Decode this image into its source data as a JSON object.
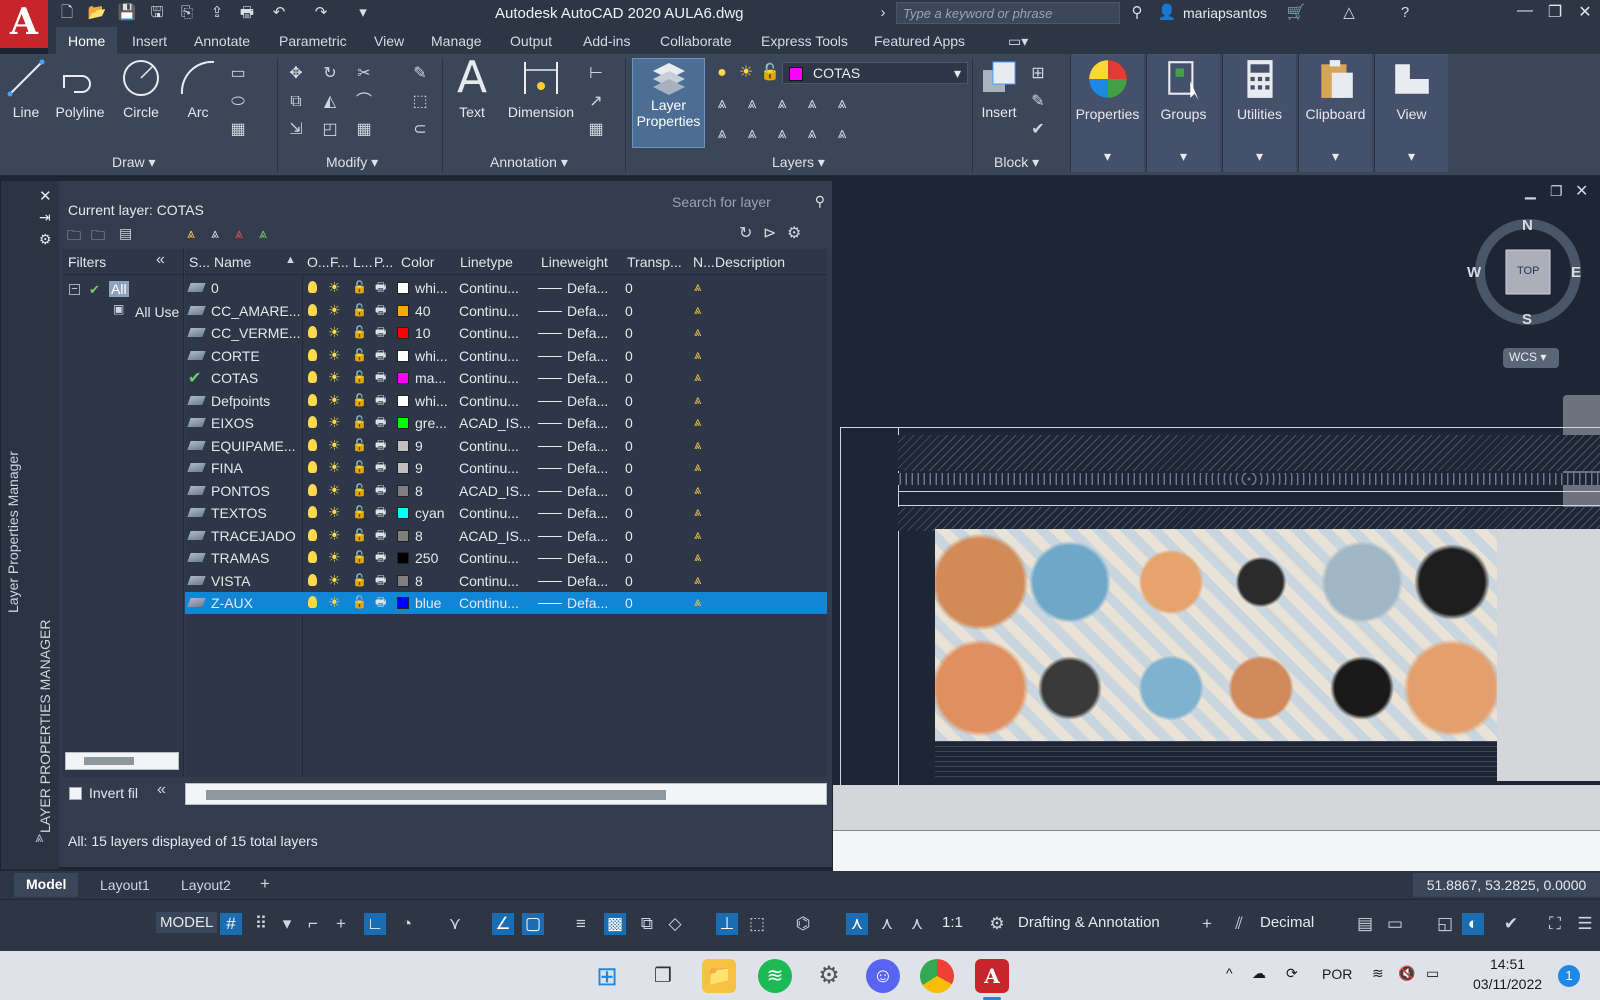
{
  "titlebar": {
    "title": "Autodesk AutoCAD 2020    AULA6.dwg",
    "search_placeholder": "Type a keyword or phrase",
    "user": "mariapsantos"
  },
  "ribbon": {
    "tabs": [
      "Home",
      "Insert",
      "Annotate",
      "Parametric",
      "View",
      "Manage",
      "Output",
      "Add-ins",
      "Collaborate",
      "Express Tools",
      "Featured Apps"
    ],
    "active_tab": "Home",
    "draw": {
      "line": "Line",
      "polyline": "Polyline",
      "circle": "Circle",
      "arc": "Arc",
      "title": "Draw"
    },
    "modify_title": "Modify",
    "annotation": {
      "text": "Text",
      "dimension": "Dimension",
      "title": "Annotation"
    },
    "layers": {
      "layer_properties_line1": "Layer",
      "layer_properties_line2": "Properties",
      "current_layer": "COTAS",
      "title": "Layers"
    },
    "block": {
      "insert": "Insert",
      "title": "Block"
    },
    "tiles": {
      "properties": "Properties",
      "groups": "Groups",
      "utilities": "Utilities",
      "clipboard": "Clipboard",
      "view": "View"
    }
  },
  "palette": {
    "rail_title": "Layer Properties Manager",
    "rail_title_caps": "LAYER PROPERTIES MANAGER",
    "current_layer": "Current layer: COTAS",
    "search_placeholder": "Search for layer",
    "filters_label": "Filters",
    "filter_all": "All",
    "filter_all_used": "All Use",
    "invert_filter": "Invert fil",
    "columns": [
      "S...",
      "Name",
      "O...",
      "F...",
      "L...",
      "P...",
      "Color",
      "Linetype",
      "Lineweight",
      "Transp...",
      "N...",
      "Description"
    ],
    "layers": [
      {
        "name": "0",
        "color_name": "whi...",
        "color": "#ffffff",
        "linetype": "Continu...",
        "lineweight": "Defa...",
        "transparency": "0",
        "current": false,
        "selected": false
      },
      {
        "name": "CC_AMARE...",
        "color_name": "40",
        "color": "#ffaa00",
        "linetype": "Continu...",
        "lineweight": "Defa...",
        "transparency": "0",
        "current": false,
        "selected": false
      },
      {
        "name": "CC_VERME...",
        "color_name": "10",
        "color": "#ff0000",
        "linetype": "Continu...",
        "lineweight": "Defa...",
        "transparency": "0",
        "current": false,
        "selected": false
      },
      {
        "name": "CORTE",
        "color_name": "whi...",
        "color": "#ffffff",
        "linetype": "Continu...",
        "lineweight": "Defa...",
        "transparency": "0",
        "current": false,
        "selected": false
      },
      {
        "name": "COTAS",
        "color_name": "ma...",
        "color": "#ff00ff",
        "linetype": "Continu...",
        "lineweight": "Defa...",
        "transparency": "0",
        "current": true,
        "selected": false
      },
      {
        "name": "Defpoints",
        "color_name": "whi...",
        "color": "#ffffff",
        "linetype": "Continu...",
        "lineweight": "Defa...",
        "transparency": "0",
        "current": false,
        "selected": false
      },
      {
        "name": "EIXOS",
        "color_name": "gre...",
        "color": "#00ff00",
        "linetype": "ACAD_IS...",
        "lineweight": "Defa...",
        "transparency": "0",
        "current": false,
        "selected": false
      },
      {
        "name": "EQUIPAME...",
        "color_name": "9",
        "color": "#c0c0c0",
        "linetype": "Continu...",
        "lineweight": "Defa...",
        "transparency": "0",
        "current": false,
        "selected": false
      },
      {
        "name": "FINA",
        "color_name": "9",
        "color": "#c0c0c0",
        "linetype": "Continu...",
        "lineweight": "Defa...",
        "transparency": "0",
        "current": false,
        "selected": false
      },
      {
        "name": "PONTOS",
        "color_name": "8",
        "color": "#808080",
        "linetype": "ACAD_IS...",
        "lineweight": "Defa...",
        "transparency": "0",
        "current": false,
        "selected": false
      },
      {
        "name": "TEXTOS",
        "color_name": "cyan",
        "color": "#00ffff",
        "linetype": "Continu...",
        "lineweight": "Defa...",
        "transparency": "0",
        "current": false,
        "selected": false
      },
      {
        "name": "TRACEJADO",
        "color_name": "8",
        "color": "#808080",
        "linetype": "ACAD_IS...",
        "lineweight": "Defa...",
        "transparency": "0",
        "current": false,
        "selected": false
      },
      {
        "name": "TRAMAS",
        "color_name": "250",
        "color": "#000000",
        "linetype": "Continu...",
        "lineweight": "Defa...",
        "transparency": "0",
        "current": false,
        "selected": false
      },
      {
        "name": "VISTA",
        "color_name": "8",
        "color": "#808080",
        "linetype": "Continu...",
        "lineweight": "Defa...",
        "transparency": "0",
        "current": false,
        "selected": false
      },
      {
        "name": "Z-AUX",
        "color_name": "blue",
        "color": "#0000ff",
        "linetype": "Continu...",
        "lineweight": "Defa...",
        "transparency": "0",
        "current": false,
        "selected": true
      }
    ],
    "status": "All: 15 layers displayed of 15 total layers"
  },
  "viewcube": {
    "north": "N",
    "south": "S",
    "east": "E",
    "west": "W",
    "face": "TOP",
    "ucs": "WCS"
  },
  "layout_tabs": [
    "Model",
    "Layout1",
    "Layout2"
  ],
  "coordinates": "51.8867, 53.2825, 0.0000",
  "statusbar": {
    "model": "MODEL",
    "scale": "1:1",
    "workspace": "Drafting & Annotation",
    "units": "Decimal"
  },
  "taskbar": {
    "language": "POR",
    "time": "14:51",
    "date": "03/11/2022",
    "notifications": "1"
  },
  "colors": {
    "accent": "#1185d6",
    "autocad_red": "#c8242b"
  }
}
